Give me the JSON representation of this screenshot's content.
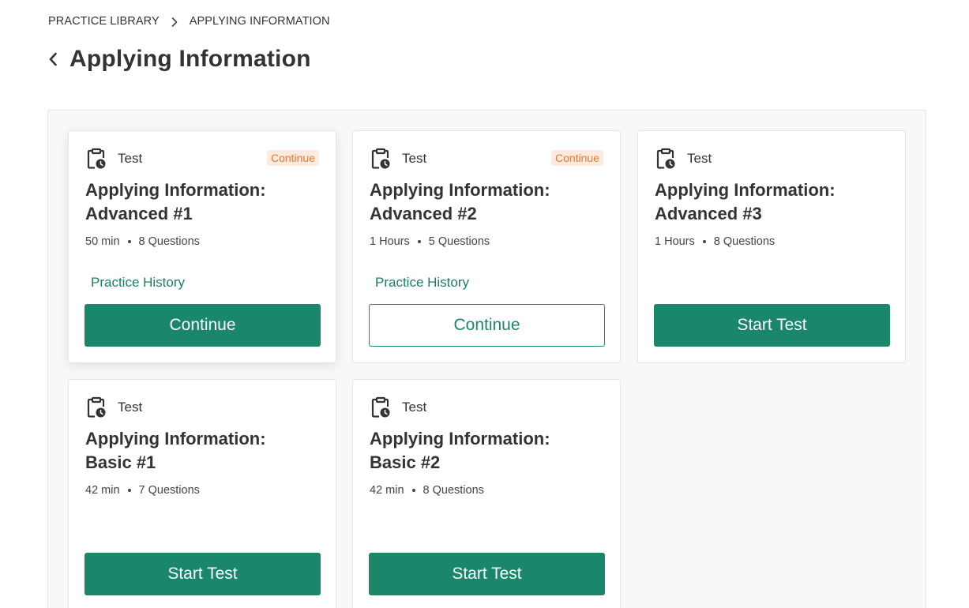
{
  "breadcrumb": {
    "root": "PRACTICE LIBRARY",
    "current": "APPLYING INFORMATION"
  },
  "page": {
    "title": "Applying Information"
  },
  "colors": {
    "accent": "#1a876a",
    "badge_bg": "#fdebe0",
    "badge_text": "#e8782e"
  },
  "cards": [
    {
      "type": "Test",
      "badge": "Continue",
      "title_line1": "Applying Information:",
      "title_line2": "Advanced #1",
      "duration": "50 min",
      "questions": "8 Questions",
      "history": "Practice History",
      "button": "Continue"
    },
    {
      "type": "Test",
      "badge": "Continue",
      "title_line1": "Applying Information:",
      "title_line2": "Advanced #2",
      "duration": "1 Hours",
      "questions": "5 Questions",
      "history": "Practice History",
      "button": "Continue"
    },
    {
      "type": "Test",
      "title_line1": "Applying Information:",
      "title_line2": "Advanced #3",
      "duration": "1 Hours",
      "questions": "8 Questions",
      "button": "Start Test"
    },
    {
      "type": "Test",
      "title_line1": "Applying Information:",
      "title_line2": "Basic #1",
      "duration": "42 min",
      "questions": "7 Questions",
      "button": "Start Test"
    },
    {
      "type": "Test",
      "title_line1": "Applying Information:",
      "title_line2": "Basic #2",
      "duration": "42 min",
      "questions": "8 Questions",
      "button": "Start Test"
    }
  ]
}
